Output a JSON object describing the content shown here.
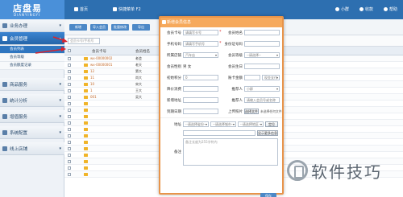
{
  "app": {
    "logo_main": "店盘易",
    "logo_sub": "DIANYINGYI",
    "header": {
      "home": "首页",
      "shortcut": "快捷菜单 F2",
      "user": "小群",
      "logout": "收款",
      "help": "帮助"
    }
  },
  "sidebar": {
    "categories": [
      {
        "label": "业务办理",
        "active": false
      },
      {
        "label": "会员管理",
        "active": true
      },
      {
        "label": "商品服务",
        "active": false
      },
      {
        "label": "统计分析",
        "active": false
      },
      {
        "label": "增值服务",
        "active": false
      },
      {
        "label": "系统配置",
        "active": false
      },
      {
        "label": "线上店铺",
        "active": false
      }
    ],
    "subitems": [
      {
        "label": "会员列表",
        "active": true
      },
      {
        "label": "会员等级",
        "active": false
      },
      {
        "label": "会员额度记录",
        "active": false
      }
    ]
  },
  "main": {
    "toolbar": [
      "新增",
      "导入会员",
      "批量修改",
      "导出"
    ],
    "search_placeholder": "会员卡号/手机号",
    "columns": [
      "会员卡号",
      "会员姓名"
    ],
    "rows": [
      {
        "card": "wx-00000002",
        "name": "老会"
      },
      {
        "card": "wx-00000001",
        "name": "老天"
      },
      {
        "card": "12",
        "name": "第大"
      },
      {
        "card": "11",
        "name": "尚大"
      },
      {
        "card": "10",
        "name": "宋大"
      },
      {
        "card": "1",
        "name": "王大"
      },
      {
        "card": "001",
        "name": "吴大"
      },
      {
        "card": "",
        "name": ""
      },
      {
        "card": "",
        "name": ""
      },
      {
        "card": "",
        "name": ""
      },
      {
        "card": "",
        "name": ""
      },
      {
        "card": "",
        "name": ""
      },
      {
        "card": "",
        "name": ""
      },
      {
        "card": "",
        "name": ""
      },
      {
        "card": "",
        "name": ""
      },
      {
        "card": "",
        "name": ""
      },
      {
        "card": "",
        "name": ""
      },
      {
        "card": "",
        "name": ""
      },
      {
        "card": "",
        "name": ""
      }
    ]
  },
  "dialog": {
    "title": "新增会员信息",
    "fields": {
      "card_no_label": "会员卡号",
      "card_no_placeholder": "请填写卡号",
      "name_label": "会员姓名",
      "phone_label": "手机号码",
      "phone_placeholder": "请填写手机号",
      "id_label": "身份证号码",
      "store_label": "所属店铺",
      "store_value": "汽车店",
      "level_label": "会员等级",
      "level_value": "--请选择--",
      "gender_label": "会员性别",
      "gender_value": "男 女",
      "birthday_label": "会员生日",
      "points_label": "初始积分",
      "points_value": "0",
      "balance_label": "账卡金额",
      "pay_value": "现金支付",
      "discount_label": "降价消费",
      "referrer_label": "推荐人",
      "referrer_value": "小群",
      "addr_label": "新增地址",
      "recommender_label": "推荐人",
      "recommender_placeholder": "请输入会员号或名称",
      "expiry_label": "到期日期",
      "avatar_label": "上传照片",
      "avatar_button": "选择文件",
      "avatar_status": "未选择任何文件",
      "region_label": "地址",
      "province": "--请选择省份--",
      "city": "--请选择城市--",
      "district": "--请选择地区--",
      "locate_button": "定位",
      "detail_button": "显示更多信息",
      "remark_label": "备注",
      "remark_placeholder": "备注长度为255字符内",
      "save_button": "保存"
    }
  },
  "watermark": "软件技巧",
  "colors": {
    "topbar": "#2d6fb0",
    "active_menu": "#2f76c0",
    "dialog_header": "#f6a95c",
    "arrow": "#d9232d"
  }
}
